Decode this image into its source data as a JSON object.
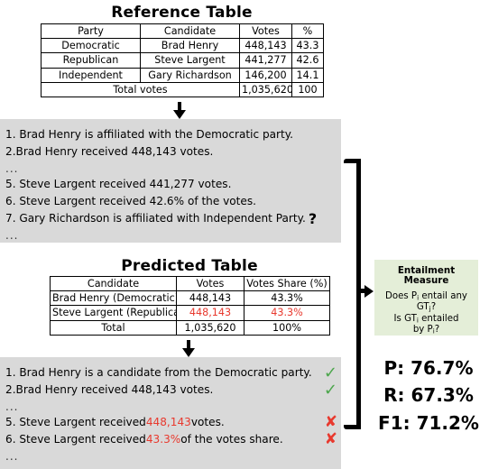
{
  "reference": {
    "title": "Reference Table",
    "columns": [
      "Party",
      "Candidate",
      "Votes",
      "%"
    ],
    "rows": [
      [
        "Democratic",
        "Brad Henry",
        "448,143",
        "43.3"
      ],
      [
        "Republican",
        "Steve Largent",
        "441,277",
        "42.6"
      ],
      [
        "Independent",
        "Gary Richardson",
        "146,200",
        "14.1"
      ]
    ],
    "total_label": "Total votes",
    "total_votes": "1,035,620",
    "total_pct": "100"
  },
  "predicted": {
    "title": "Predicted Table",
    "columns": [
      "Candidate",
      "Votes",
      "Votes Share (%)"
    ],
    "rows": [
      {
        "candidate": "Brad Henry (Democratic)",
        "votes": "448,143",
        "share": "43.3%",
        "error": false
      },
      {
        "candidate": "Steve Largent (Republican)",
        "votes": "448,143",
        "share": "43.3%",
        "error": true
      }
    ],
    "total_label": "Total",
    "total_votes": "1,035,620",
    "total_share": "100%"
  },
  "reference_sentences": {
    "lines": [
      {
        "text": "1. Brad Henry is affiliated with the Democratic party.",
        "mark": ""
      },
      {
        "text": "2.Brad Henry received 448,143 votes.",
        "mark": ""
      },
      {
        "text": "...",
        "mark": ""
      },
      {
        "text": "5. Steve Largent received 441,277 votes.",
        "mark": ""
      },
      {
        "text": "6. Steve Largent received 42.6% of the votes.",
        "mark": ""
      },
      {
        "text": "7. Gary Richardson is affiliated with Independent Party.",
        "mark": "?"
      },
      {
        "text": "...",
        "mark": ""
      }
    ]
  },
  "predicted_sentences": {
    "lines": [
      {
        "pre": "1. Brad Henry is a candidate from the Democratic party.",
        "err": "",
        "post": "",
        "mark": "check"
      },
      {
        "pre": "2.Brad Henry received 448,143 votes.",
        "err": "",
        "post": "",
        "mark": "check"
      },
      {
        "pre": "...",
        "err": "",
        "post": "",
        "mark": ""
      },
      {
        "pre": "5. Steve Largent received ",
        "err": "448,143",
        "post": " votes.",
        "mark": "cross"
      },
      {
        "pre": "6. Steve Largent received ",
        "err": "43.3%",
        "post": " of the votes share.",
        "mark": "cross"
      },
      {
        "pre": "...",
        "err": "",
        "post": "",
        "mark": ""
      }
    ]
  },
  "entailment": {
    "title": "Entailment Measure",
    "q1_a": "Does P",
    "q1_sub": "i",
    "q1_b": " entail any",
    "q2_a": "GT",
    "q2_sub": "j",
    "q2_b": "?",
    "q3_a": "Is GT",
    "q3_sub": "i",
    "q3_b": " entailed",
    "q4_a": "by P",
    "q4_sub": "i",
    "q4_b": "?"
  },
  "metrics": {
    "precision": "P:  76.7%",
    "recall": "R: 67.3%",
    "f1": "F1: 71.2%"
  },
  "colors": {
    "error_red": "#e8392e",
    "check_green": "#4ca64c",
    "gray_box": "#d9d9d9",
    "entail_green": "#e4eed8"
  },
  "icons": {
    "check": "✓",
    "cross": "✘",
    "question": "?"
  }
}
